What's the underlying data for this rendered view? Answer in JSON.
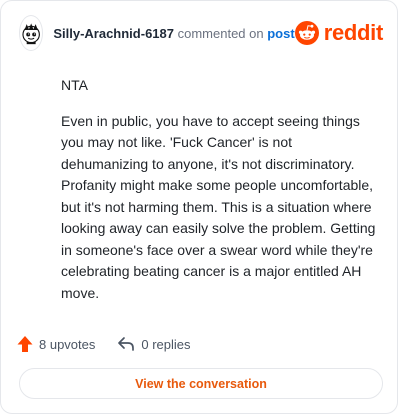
{
  "header": {
    "username": "Silly-Arachnid-6187",
    "action_text": "commented on",
    "post_link": "post",
    "brand": "reddit"
  },
  "comment": {
    "paragraphs": [
      "NTA",
      "Even in public, you have to accept seeing things you may not like. 'Fuck Cancer' is not dehumanizing to anyone, it's not discriminatory. Profanity might make some people uncomfortable, but it's not harming them. This is a situation where looking away can easily solve the problem. Getting in someone's face over a swear word while they're celebrating beating cancer is a major entitled AH move."
    ]
  },
  "actions": {
    "upvotes": "8 upvotes",
    "replies": "0 replies"
  },
  "cta": {
    "label": "View the conversation"
  },
  "colors": {
    "accent": "#ff4500",
    "link": "#0a6fd8",
    "cta_text": "#e8590c"
  }
}
